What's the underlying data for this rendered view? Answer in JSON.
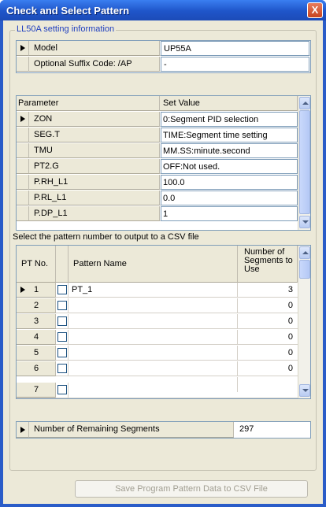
{
  "window": {
    "title": "Check and Select Pattern",
    "close_label": "X"
  },
  "group": {
    "title": "LL50A setting information"
  },
  "model_table": {
    "rows": [
      {
        "label": "Model",
        "value": "UP55A"
      },
      {
        "label": "Optional Suffix Code: /AP",
        "value": "-"
      }
    ]
  },
  "param_table": {
    "headers": {
      "parameter": "Parameter",
      "value": "Set Value"
    },
    "rows": [
      {
        "name": "ZON",
        "value": "0:Segment PID selection"
      },
      {
        "name": "SEG.T",
        "value": "TIME:Segment time setting"
      },
      {
        "name": "TMU",
        "value": "MM.SS:minute.second"
      },
      {
        "name": "PT2.G",
        "value": "OFF:Not used."
      },
      {
        "name": "P.RH_L1",
        "value": "100.0"
      },
      {
        "name": "P.RL_L1",
        "value": "0.0"
      },
      {
        "name": "P.DP_L1",
        "value": "1"
      }
    ]
  },
  "pattern_section": {
    "caption": "Select the pattern number to output to a CSV file",
    "headers": {
      "pt_no": "PT No.",
      "name": "Pattern Name",
      "segments": "Number of Segments to Use"
    },
    "rows": [
      {
        "pt": "1",
        "name": "PT_1",
        "segments": "3"
      },
      {
        "pt": "2",
        "name": "",
        "segments": "0"
      },
      {
        "pt": "3",
        "name": "",
        "segments": "0"
      },
      {
        "pt": "4",
        "name": "",
        "segments": "0"
      },
      {
        "pt": "5",
        "name": "",
        "segments": "0"
      },
      {
        "pt": "6",
        "name": "",
        "segments": "0"
      },
      {
        "pt": "7",
        "name": "",
        "segments": ""
      }
    ]
  },
  "remaining": {
    "label": "Number of Remaining Segments",
    "value": "297"
  },
  "save_button": {
    "label": "Save Program Pattern Data to CSV File"
  }
}
